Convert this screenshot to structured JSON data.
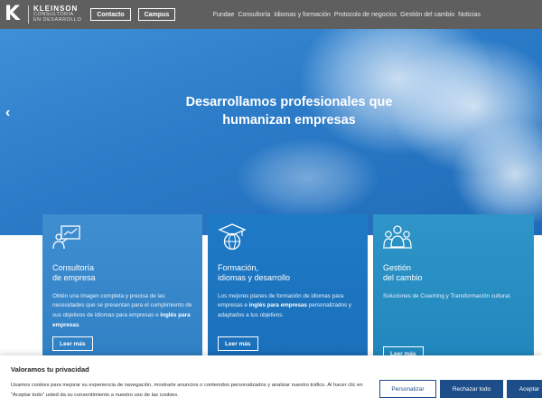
{
  "header": {
    "logo_letter": "K",
    "logo_name": "KLEINSON",
    "logo_sub1": "CONSULTORIA",
    "logo_sub2": "EN DESARROLLO",
    "contact_btn": "Contacto",
    "campus_btn": "Campus",
    "nav": [
      "Fundae",
      "Consultoría",
      "Idiomas y formación",
      "Protocolo de negocios",
      "Gestión del cambio",
      "Noticias"
    ]
  },
  "hero": {
    "title_line1": "Desarrollamos profesionales que",
    "title_line2": "humanizan empresas",
    "prev_arrow": "‹"
  },
  "cards": [
    {
      "icon": "presentation-board-icon",
      "title_line1": "Consultoría",
      "title_line2": "de empresa",
      "desc": "Obtén una imagen completa y precisa de las necesidades que se presentan para el cumplimiento de sus objetivos de idiomas para empresas e ",
      "desc_bold": "inglés para empresas",
      "desc_end": ".",
      "button": "Leer más"
    },
    {
      "icon": "graduation-globe-icon",
      "title_line1": "Formación,",
      "title_line2": "idiomas y desarrollo",
      "desc": "Los mejores planes de formación de idiomas para empresas e ",
      "desc_bold": "inglés para empresas",
      "desc_end": " personalizados y adaptados a tus objetivos.",
      "button": "Leer más"
    },
    {
      "icon": "team-people-icon",
      "title_line1": "Gestión",
      "title_line2": "del cambio",
      "desc": "Soluciones de Coaching y Transformación cultural.",
      "desc_bold": "",
      "desc_end": "",
      "button": "Leer más"
    }
  ],
  "cookie": {
    "title": "Valoramos tu privacidad",
    "text": "Usamos cookies para mejorar su experiencia de navegación, mostrarle anuncios o contenidos personalizados y analizar nuestro tráfico. Al hacer clic en \"Aceptar todo\" usted da su consentimiento a nuestro uso de las cookies.",
    "customize": "Personalizar",
    "reject": "Rechazar todo",
    "accept": "Aceptar"
  }
}
